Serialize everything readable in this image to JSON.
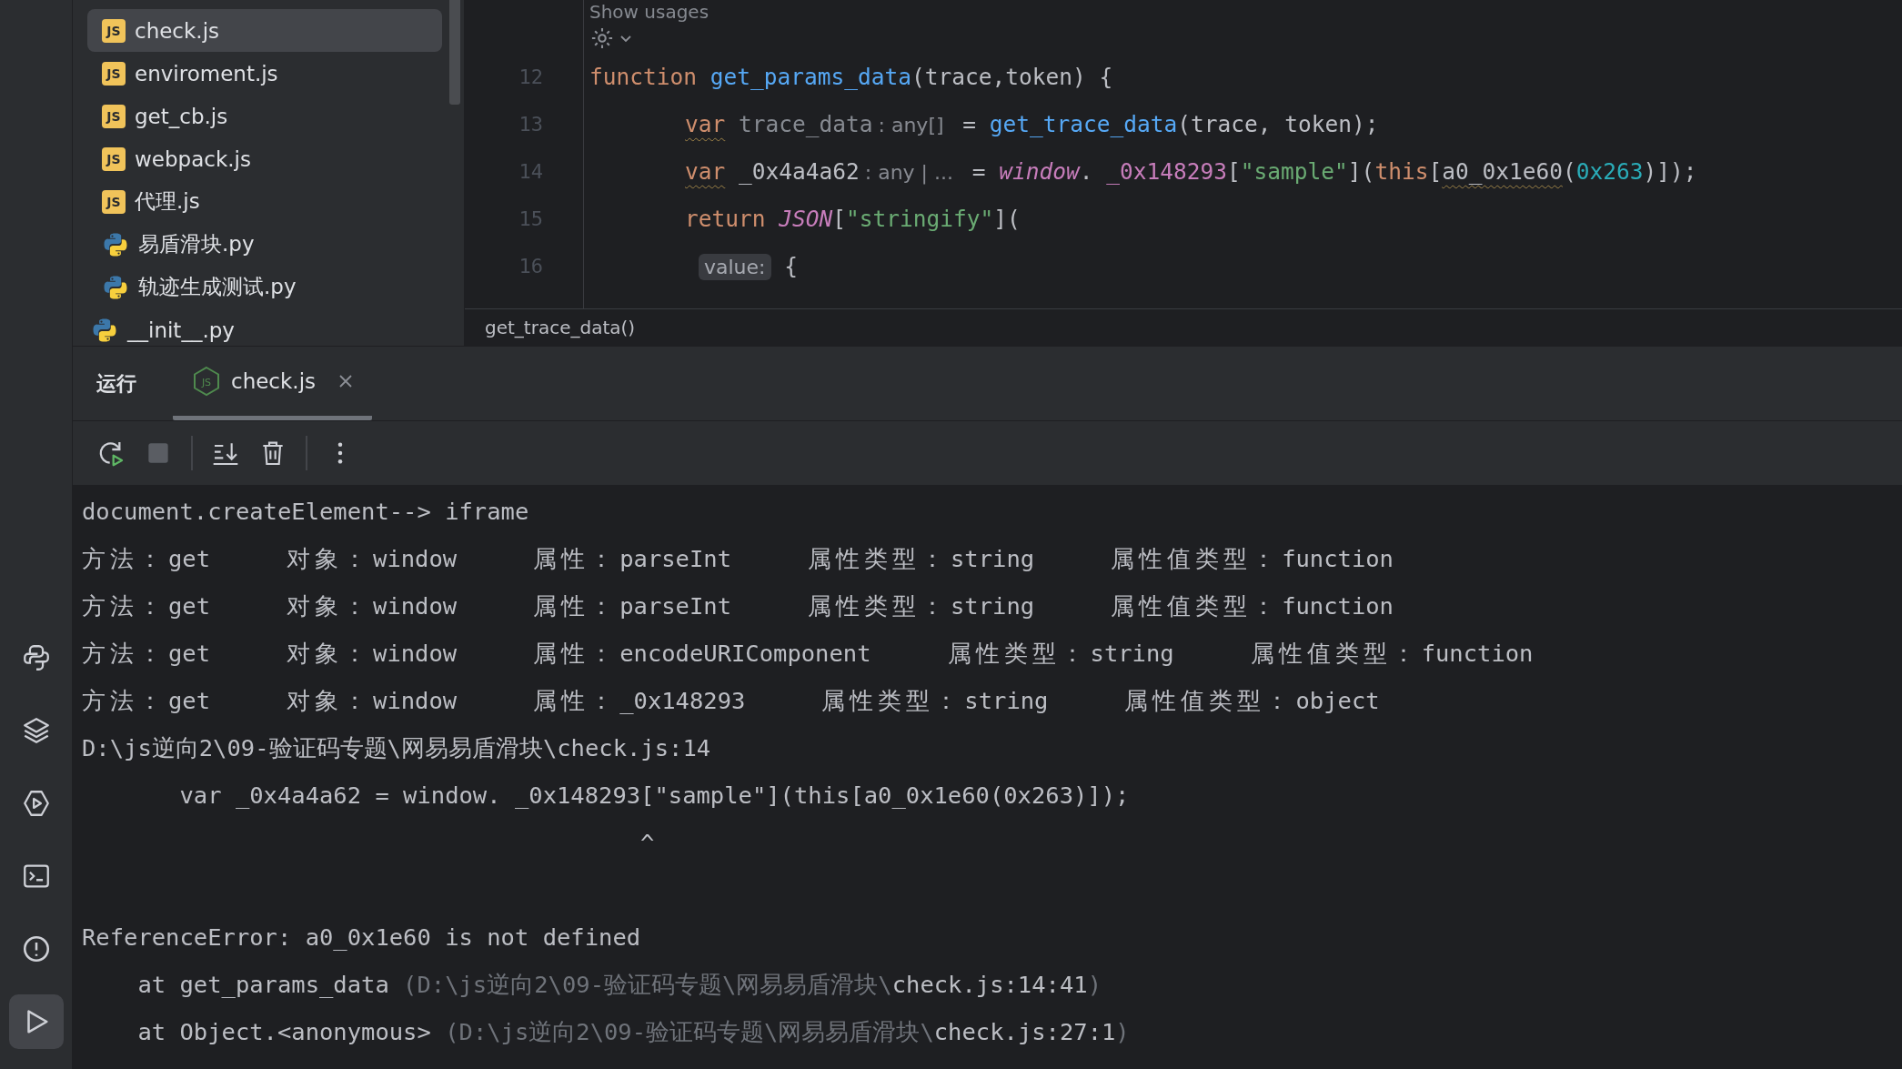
{
  "activity_bar": {
    "items": [
      {
        "kind": "python",
        "selected": false
      },
      {
        "kind": "layers",
        "selected": false
      },
      {
        "kind": "services",
        "selected": false
      },
      {
        "kind": "terminal",
        "selected": false
      },
      {
        "kind": "problems",
        "selected": false
      },
      {
        "kind": "run",
        "selected": true
      }
    ]
  },
  "project_tree": {
    "open_folder": {
      "children": [
        {
          "label": "check.js",
          "kind": "js",
          "icon_text": "JS",
          "selected": true
        },
        {
          "label": "enviroment.js",
          "kind": "js",
          "icon_text": "JS",
          "selected": false
        },
        {
          "label": "get_cb.js",
          "kind": "js",
          "icon_text": "JS",
          "selected": false
        },
        {
          "label": "webpack.js",
          "kind": "js",
          "icon_text": "JS",
          "selected": false
        },
        {
          "label": "代理.js",
          "kind": "js",
          "icon_text": "JS",
          "selected": false
        },
        {
          "label": "易盾滑块.py",
          "kind": "py",
          "selected": false
        },
        {
          "label": "轨迹生成测试.py",
          "kind": "py",
          "selected": false
        }
      ]
    },
    "items": [
      {
        "label": "__init__.py",
        "kind": "py",
        "selected": false
      }
    ]
  },
  "editor": {
    "usages_hint": "Show usages",
    "lines": [
      {
        "number": "12",
        "kind": "top",
        "tokens": [
          {
            "kind": "keyword",
            "text": "function "
          },
          {
            "kind": "function",
            "text": "get_params_data"
          },
          {
            "kind": "plain",
            "text": "(trace,token) {"
          }
        ]
      },
      {
        "number": "13",
        "kind": "body",
        "tokens": [
          {
            "kind": "keyword",
            "text": "var",
            "underline": true
          },
          {
            "kind": "unused",
            "text": " trace_data"
          },
          {
            "kind": "type_hint",
            "text": ": any[]"
          },
          {
            "kind": "plain",
            "text": " = "
          },
          {
            "kind": "function",
            "text": "get_trace_data"
          },
          {
            "kind": "plain",
            "text": "(trace, token);"
          }
        ]
      },
      {
        "number": "14",
        "kind": "body",
        "tokens": [
          {
            "kind": "keyword",
            "text": "var",
            "underline": true
          },
          {
            "kind": "plain",
            "text": " _0x4a4a62"
          },
          {
            "kind": "type_hint",
            "text": ": any | ..."
          },
          {
            "kind": "plain",
            "text": " = "
          },
          {
            "kind": "global",
            "text": "window"
          },
          {
            "kind": "plain",
            "text": ". "
          },
          {
            "kind": "member",
            "text": "_0x148293"
          },
          {
            "kind": "plain",
            "text": "["
          },
          {
            "kind": "string",
            "text": "\"sample\""
          },
          {
            "kind": "plain",
            "text": "]("
          },
          {
            "kind": "keyword",
            "text": "this"
          },
          {
            "kind": "plain",
            "text": "["
          },
          {
            "kind": "plain",
            "text": "a0_0x1e60",
            "underline": true
          },
          {
            "kind": "plain",
            "text": "("
          },
          {
            "kind": "number",
            "text": "0x263"
          },
          {
            "kind": "plain",
            "text": ")]);"
          }
        ]
      },
      {
        "number": "15",
        "kind": "body",
        "tokens": [
          {
            "kind": "keyword",
            "text": "return "
          },
          {
            "kind": "global",
            "text": "JSON"
          },
          {
            "kind": "plain",
            "text": "["
          },
          {
            "kind": "string",
            "text": "\"stringify\""
          },
          {
            "kind": "plain",
            "text": "]("
          }
        ]
      },
      {
        "number": "16",
        "kind": "argument",
        "tokens": [
          {
            "kind": "param_hint",
            "text": "value:"
          },
          {
            "kind": "plain",
            "text": " {"
          }
        ]
      }
    ],
    "breadcrumb": "get_trace_data()"
  },
  "run_panel": {
    "title": "运行",
    "tabs": [
      {
        "label": "check.js",
        "icon_text": "JS",
        "selected": true
      }
    ],
    "toolbar": [
      [
        {
          "kind": "rerun",
          "disabled": false
        },
        {
          "kind": "stop",
          "disabled": true
        }
      ],
      [
        {
          "kind": "scroll_end",
          "disabled": false
        },
        {
          "kind": "clear",
          "disabled": false
        }
      ],
      [
        {
          "kind": "more",
          "disabled": false
        }
      ]
    ],
    "console": [
      {
        "kind": "text",
        "text": "document.createElement--> iframe"
      },
      {
        "kind": "fields",
        "fields": [
          {
            "label": "方法：",
            "value": "get"
          },
          {
            "label": "对象：",
            "value": "window"
          },
          {
            "label": "属性：",
            "value": "parseInt"
          },
          {
            "label": "属性类型：",
            "value": "string"
          },
          {
            "label": "属性值类型：",
            "value": "function"
          }
        ]
      },
      {
        "kind": "fields",
        "fields": [
          {
            "label": "方法：",
            "value": "get"
          },
          {
            "label": "对象：",
            "value": "window"
          },
          {
            "label": "属性：",
            "value": "parseInt"
          },
          {
            "label": "属性类型：",
            "value": "string"
          },
          {
            "label": "属性值类型：",
            "value": "function"
          }
        ]
      },
      {
        "kind": "fields",
        "fields": [
          {
            "label": "方法：",
            "value": "get"
          },
          {
            "label": "对象：",
            "value": "window"
          },
          {
            "label": "属性：",
            "value": "encodeURIComponent"
          },
          {
            "label": "属性类型：",
            "value": "string"
          },
          {
            "label": "属性值类型：",
            "value": "function"
          }
        ]
      },
      {
        "kind": "fields",
        "fields": [
          {
            "label": "方法：",
            "value": "get"
          },
          {
            "label": "对象：",
            "value": "window"
          },
          {
            "label": "属性：",
            "value": "_0x148293"
          },
          {
            "label": "属性类型：",
            "value": "string"
          },
          {
            "label": "属性值类型：",
            "value": "object"
          }
        ]
      },
      {
        "kind": "text",
        "text": "D:\\js逆向2\\09-验证码专题\\网易易盾滑块\\check.js:14"
      },
      {
        "kind": "text",
        "text": "       var _0x4a4a62 = window. _0x148293[\"sample\"](this[a0_0x1e60(0x263)]);"
      },
      {
        "kind": "text",
        "text": "                                        ^"
      },
      {
        "kind": "blank"
      },
      {
        "kind": "text",
        "text": "ReferenceError: a0_0x1e60 is not defined"
      },
      {
        "kind": "segments",
        "segments": [
          {
            "text": "    at get_params_data ",
            "dim": false
          },
          {
            "text": "(D:\\js逆向2\\09-验证码专题\\网易易盾滑块\\",
            "dim": true
          },
          {
            "text": "check.js:14:41",
            "dim": false
          },
          {
            "text": ")",
            "dim": true
          }
        ]
      },
      {
        "kind": "segments",
        "segments": [
          {
            "text": "    at Object.<anonymous> ",
            "dim": false
          },
          {
            "text": "(D:\\js逆向2\\09-验证码专题\\网易易盾滑块\\",
            "dim": true
          },
          {
            "text": "check.js:27:1",
            "dim": false
          },
          {
            "text": ")",
            "dim": true
          }
        ]
      }
    ]
  }
}
